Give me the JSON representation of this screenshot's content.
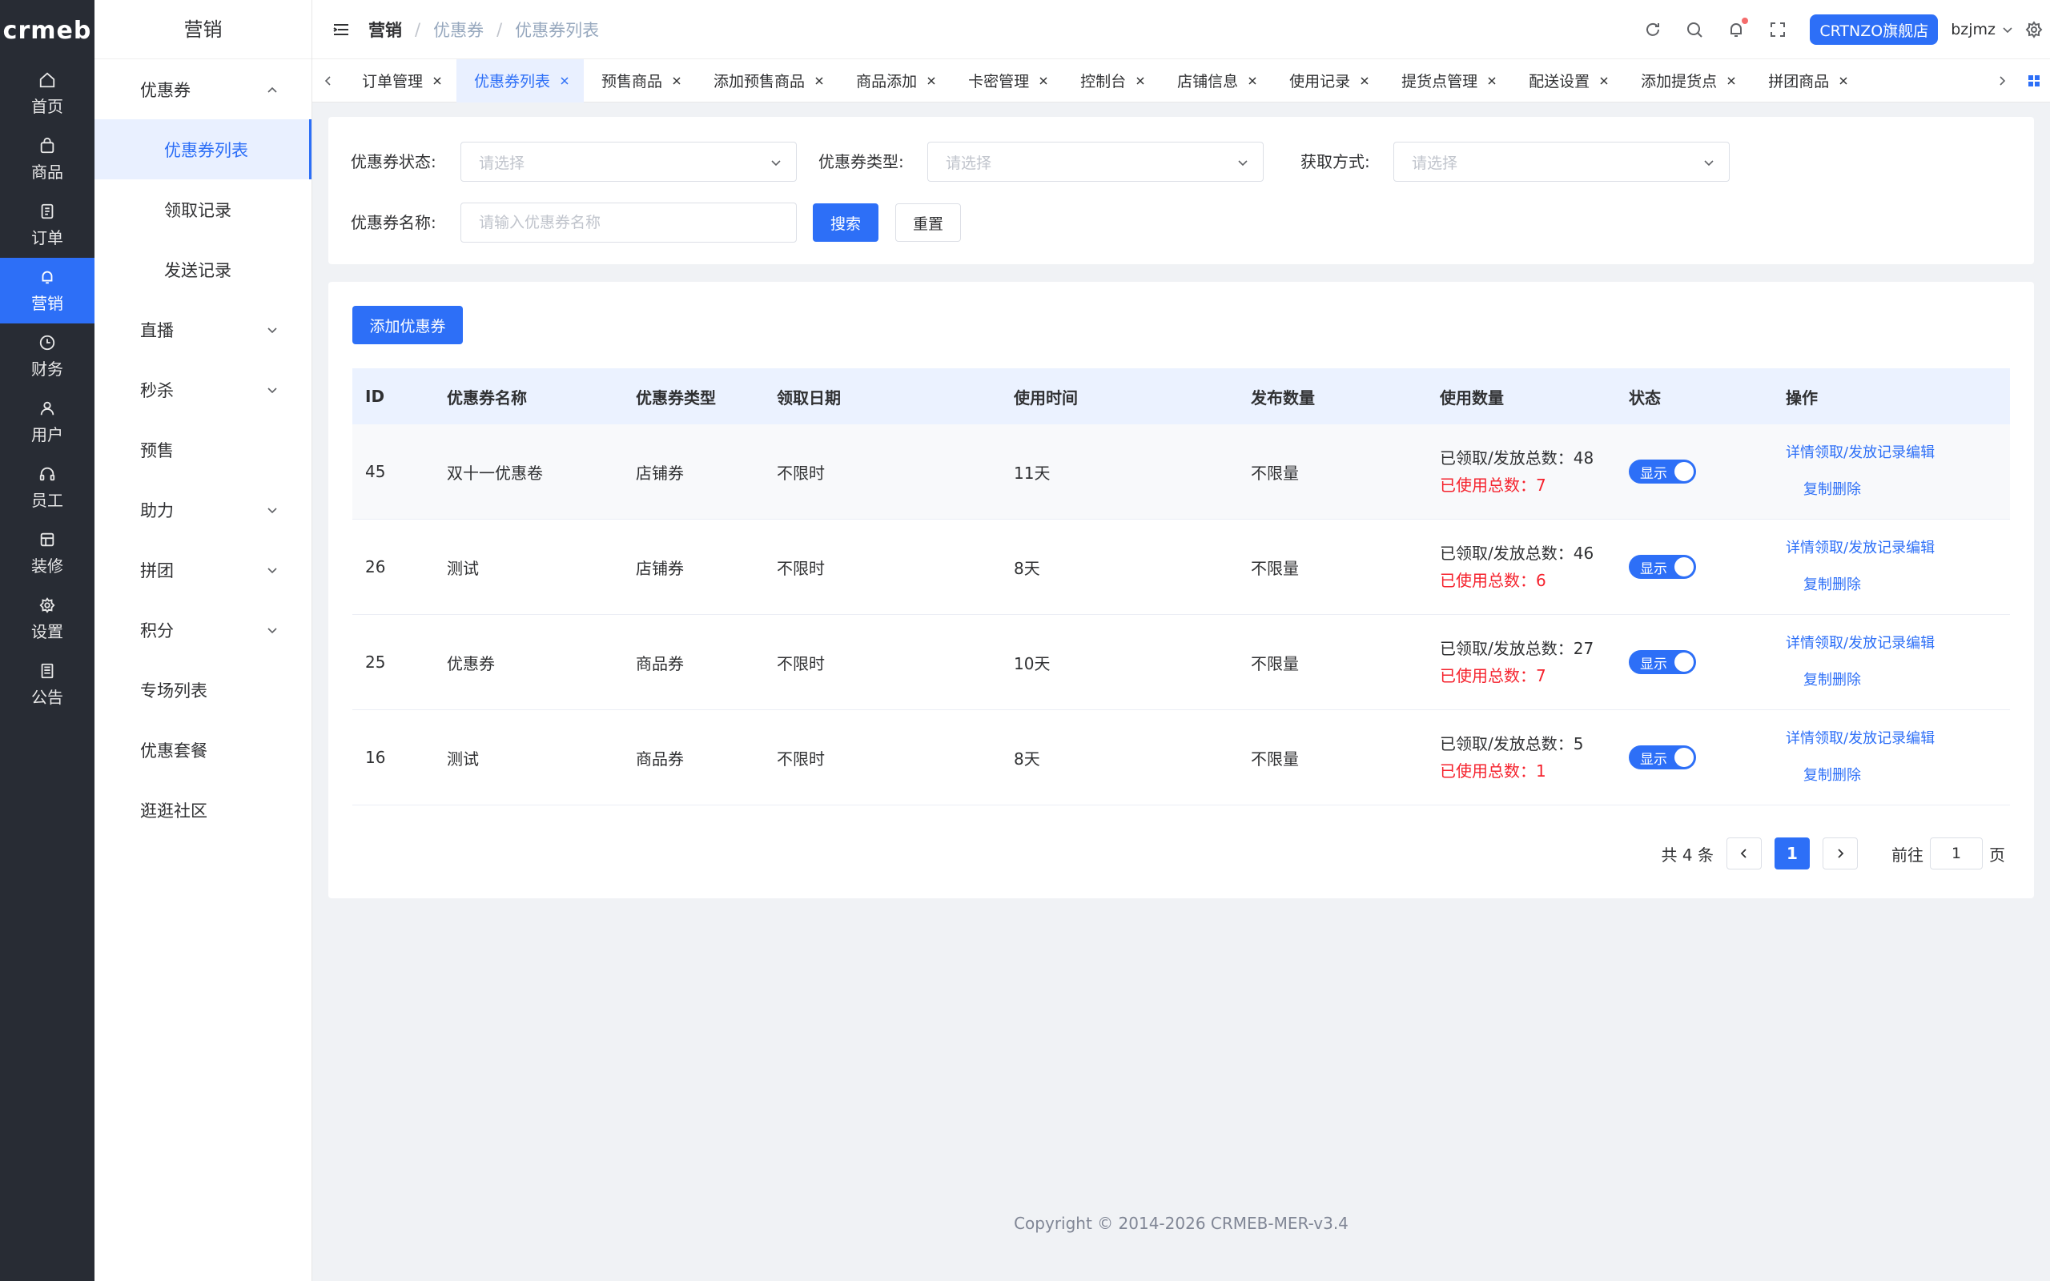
{
  "logo": "crmeb",
  "nav1": [
    {
      "label": "首页",
      "icon": "home-icon"
    },
    {
      "label": "商品",
      "icon": "bag-icon"
    },
    {
      "label": "订单",
      "icon": "document-icon"
    },
    {
      "label": "营销",
      "icon": "bell-icon",
      "active": true
    },
    {
      "label": "财务",
      "icon": "clock-icon"
    },
    {
      "label": "用户",
      "icon": "user-icon"
    },
    {
      "label": "员工",
      "icon": "headset-icon"
    },
    {
      "label": "装修",
      "icon": "box-icon"
    },
    {
      "label": "设置",
      "icon": "gear-icon"
    },
    {
      "label": "公告",
      "icon": "notice-icon"
    }
  ],
  "nav2": {
    "title": "营销",
    "coupon": "优惠券",
    "coupon_list": "优惠券列表",
    "receive_records": "领取记录",
    "send_records": "发送记录",
    "live": "直播",
    "seckill": "秒杀",
    "presale": "预售",
    "assist": "助力",
    "group": "拼团",
    "points": "积分",
    "special": "专场列表",
    "package": "优惠套餐",
    "community": "逛逛社区"
  },
  "header": {
    "crumbs": [
      "营销",
      "优惠券",
      "优惠券列表"
    ],
    "store": "CRTNZO旗舰店",
    "user": "bzjmz"
  },
  "tabs": [
    "订单管理",
    "优惠券列表",
    "预售商品",
    "添加预售商品",
    "商品添加",
    "卡密管理",
    "控制台",
    "店铺信息",
    "使用记录",
    "提货点管理",
    "配送设置",
    "添加提货点",
    "拼团商品"
  ],
  "filter": {
    "status_label": "优惠券状态:",
    "status_placeholder": "请选择",
    "type_label": "优惠券类型:",
    "type_placeholder": "请选择",
    "method_label": "获取方式:",
    "method_placeholder": "请选择",
    "name_label": "优惠券名称:",
    "name_placeholder": "请输入优惠券名称",
    "search": "搜索",
    "reset": "重置"
  },
  "add_button": "添加优惠券",
  "table": {
    "headers": [
      "ID",
      "优惠券名称",
      "优惠券类型",
      "领取日期",
      "使用时间",
      "发布数量",
      "使用数量",
      "状态",
      "操作"
    ],
    "rows": [
      {
        "id": "45",
        "name": "双十一优惠卷",
        "type": "店铺券",
        "date": "不限时",
        "time": "11天",
        "issue": "不限量",
        "received": "已领取/发放总数：48",
        "used": "已使用总数：7",
        "status": "显示"
      },
      {
        "id": "26",
        "name": "测试",
        "type": "店铺券",
        "date": "不限时",
        "time": "8天",
        "issue": "不限量",
        "received": "已领取/发放总数：46",
        "used": "已使用总数：6",
        "status": "显示"
      },
      {
        "id": "25",
        "name": "优惠券",
        "type": "商品券",
        "date": "不限时",
        "time": "10天",
        "issue": "不限量",
        "received": "已领取/发放总数：27",
        "used": "已使用总数：7",
        "status": "显示"
      },
      {
        "id": "16",
        "name": "测试",
        "type": "商品券",
        "date": "不限时",
        "time": "8天",
        "issue": "不限量",
        "received": "已领取/发放总数：5",
        "used": "已使用总数：1",
        "status": "显示"
      }
    ],
    "ops": {
      "detail": "详情",
      "records": "领取/发放记录",
      "edit": "编辑",
      "copy": "复制",
      "delete": "删除"
    }
  },
  "pagination": {
    "total": "共 4 条",
    "current": "1",
    "goto": "前往",
    "page_value": "1",
    "page_unit": "页"
  },
  "footer": "Copyright © 2014-2026 CRMEB-MER-v3.4",
  "colors": {
    "primary": "#2d6ff7",
    "sidebar": "#282c34",
    "danger": "#f5222d"
  }
}
